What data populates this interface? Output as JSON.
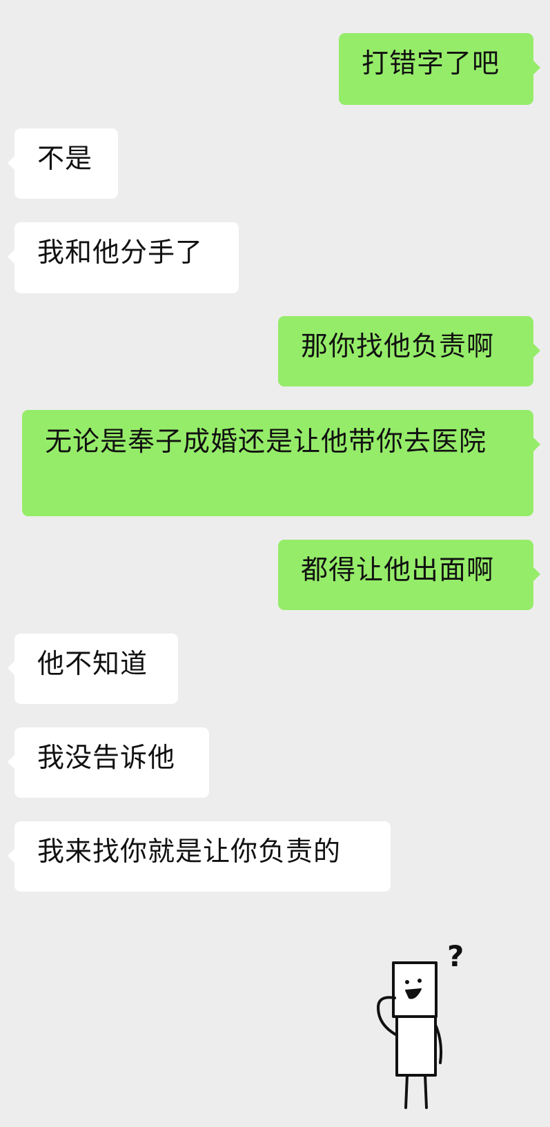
{
  "messages": [
    {
      "side": "right",
      "text": "打错字了吧"
    },
    {
      "side": "left",
      "text": "不是"
    },
    {
      "side": "left",
      "text": "我和他分手了"
    },
    {
      "side": "right",
      "text": "那你找他负责啊"
    },
    {
      "side": "right",
      "text": "无论是奉子成婚还是让他带你去医院"
    },
    {
      "side": "right",
      "text": "都得让他出面啊"
    },
    {
      "side": "left",
      "text": "他不知道"
    },
    {
      "side": "left",
      "text": "我没告诉他"
    },
    {
      "side": "left",
      "text": "我来找你就是让你负责的"
    }
  ],
  "sticker": {
    "name": "confused-stick-figure",
    "text": "?"
  },
  "colors": {
    "background": "#ededed",
    "incoming_bubble": "#ffffff",
    "outgoing_bubble": "#95ec69",
    "text": "#111111"
  }
}
